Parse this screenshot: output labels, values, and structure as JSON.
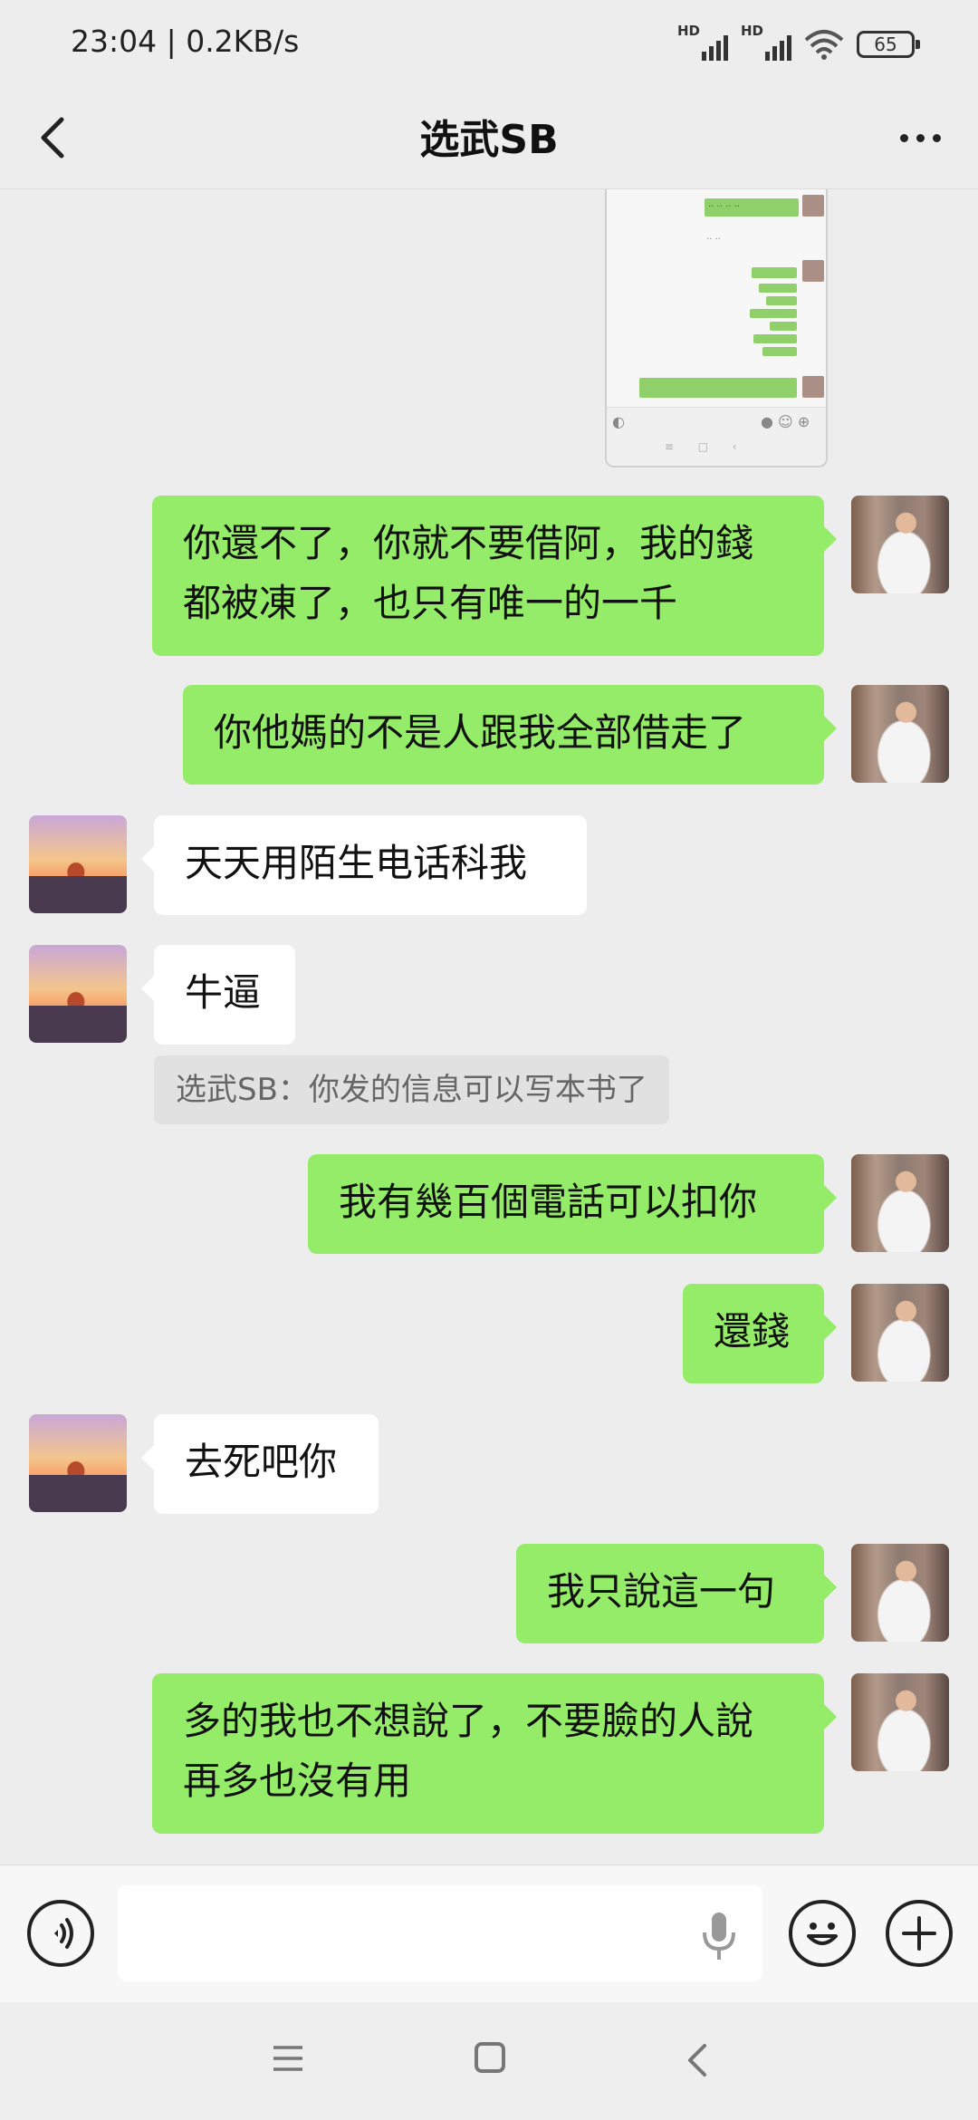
{
  "status_bar": {
    "time": "23:04 | 0.2KB/s",
    "signal_1_label": "HD",
    "signal_2_label": "HD",
    "battery": "65"
  },
  "header": {
    "title": "选武SB",
    "back_icon": "chevron-left-icon",
    "more_icon": "ellipsis-icon"
  },
  "colors": {
    "background": "#ededed",
    "my_bubble": "#95ec69",
    "their_bubble": "#ffffff"
  },
  "messages": [
    {
      "from": "me",
      "type": "image",
      "text": ""
    },
    {
      "from": "me",
      "type": "text",
      "text": "你還不了，你就不要借阿，我的錢\n都被凍了，也只有唯一的一千"
    },
    {
      "from": "me",
      "type": "text",
      "text": "你他媽的不是人跟我全部借走了"
    },
    {
      "from": "other",
      "type": "text",
      "text": "天天用陌生电话科我"
    },
    {
      "from": "other",
      "type": "text",
      "text": "牛逼"
    },
    {
      "from": "quote",
      "type": "quote",
      "text": "选武SB：你发的信息可以写本书了"
    },
    {
      "from": "me",
      "type": "text",
      "text": "我有幾百個電話可以扣你"
    },
    {
      "from": "me",
      "type": "text",
      "text": "還錢"
    },
    {
      "from": "other",
      "type": "text",
      "text": "去死吧你"
    },
    {
      "from": "me",
      "type": "text",
      "text": "我只說這一句"
    },
    {
      "from": "me",
      "type": "text",
      "text": "多的我也不想說了，不要臉的人說\n再多也沒有用"
    }
  ],
  "input_bar": {
    "voice_icon": "voice-icon",
    "mic_icon": "microphone-icon",
    "emoji_icon": "emoji-icon",
    "plus_icon": "plus-icon",
    "value": ""
  },
  "nav_bar": {
    "menu_icon": "menu-icon",
    "home_icon": "home-icon",
    "back_icon": "back-icon"
  }
}
